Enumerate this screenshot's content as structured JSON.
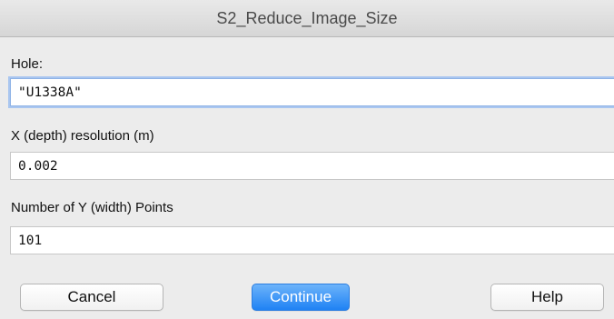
{
  "window": {
    "title": "S2_Reduce_Image_Size"
  },
  "fields": {
    "hole": {
      "label": "Hole:",
      "value": "\"U1338A\""
    },
    "x_resolution": {
      "label": "X (depth) resolution (m)",
      "value": "0.002"
    },
    "y_points": {
      "label": "Number of Y (width) Points",
      "value": "101"
    }
  },
  "buttons": {
    "cancel": "Cancel",
    "continue": "Continue",
    "help": "Help"
  },
  "colors": {
    "primary_button": "#2a88f5",
    "focus_ring": "#a9c6f0",
    "window_bg": "#ececec"
  }
}
